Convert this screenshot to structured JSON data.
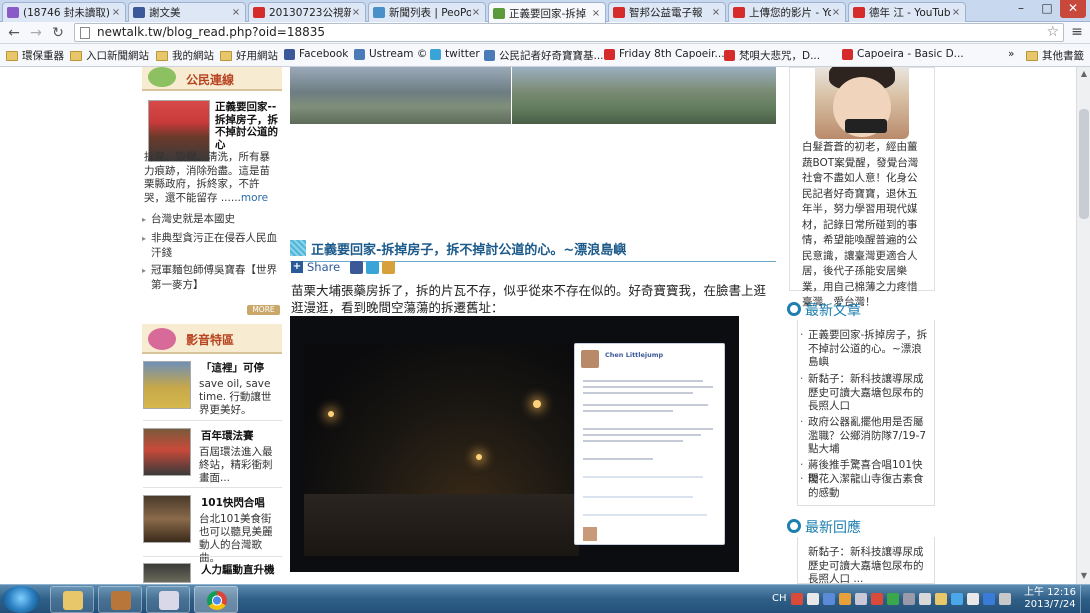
{
  "browser": {
    "tabs": [
      {
        "title": "(18746 封未讀取)",
        "icon": "mail"
      },
      {
        "title": "謝文美",
        "icon": "facebook"
      },
      {
        "title": "20130723公視新",
        "icon": "youtube"
      },
      {
        "title": "新聞列表 | PeoPo",
        "icon": "peopo"
      },
      {
        "title": "正義要回家-拆掉",
        "icon": "newtalk",
        "active": true
      },
      {
        "title": "智邦公益電子報",
        "icon": "youtube"
      },
      {
        "title": "上傳您的影片 - Yo",
        "icon": "youtube"
      },
      {
        "title": "德年 江 - YouTub",
        "icon": "youtube"
      }
    ],
    "url": "newtalk.tw/blog_read.php?oid=18835",
    "window_controls": [
      "–",
      "□",
      "✕"
    ],
    "bookmarks": [
      {
        "label": "環保重器",
        "type": "folder"
      },
      {
        "label": "入口新聞網站",
        "type": "folder"
      },
      {
        "label": "我的網站",
        "type": "folder"
      },
      {
        "label": "好用網站",
        "type": "folder"
      },
      {
        "label": "Facebook",
        "type": "facebook"
      },
      {
        "label": "Ustream ©",
        "type": "ustream"
      },
      {
        "label": "twitter",
        "type": "twitter"
      },
      {
        "label": "公民記者好奇寶寶基...",
        "type": "ustream"
      },
      {
        "label": "Friday 8th Capoeir...",
        "type": "youtube"
      },
      {
        "label": "梵唄大悲咒，D...",
        "type": "youtube"
      },
      {
        "label": "Capoeira - Basic D...",
        "type": "youtube"
      },
      {
        "label": "»",
        "type": "more"
      },
      {
        "label": "其他書籤",
        "type": "folder"
      }
    ]
  },
  "left_sidebar": {
    "citizen_links_title": "公民連線",
    "featured": {
      "title": "正義要回家--拆掉房子，拆不掉討公道的心",
      "snippet": "拆屋、毀欄、淸洗，所有暴力痕跡，消除殆盡。這是苗栗縣政府，拆終家，不許哭，還不能留存 ......",
      "more": "more"
    },
    "links": [
      "台灣史就是本國史",
      "非典型貪污正在侵吞人民血汗錢",
      "冠軍麵包師傅吳寶春【世界第一麥方】"
    ],
    "more_badge": "MORE",
    "video_title": "影音特區",
    "videos": [
      {
        "title": "「這裡」可停",
        "desc": "save oil, save time. 行動讓世界更美好。"
      },
      {
        "title": "百年環法賽",
        "desc": "百屆環法進入最終站，精彩衝刺畫面..."
      },
      {
        "title": "101快閃合唱",
        "desc": "台北101美食街也可以聽見美麗動人的台灣歌曲。"
      },
      {
        "title": "人力驅動直升機",
        "desc": ""
      }
    ]
  },
  "article": {
    "title": "正義要回家-拆掉房子，拆不掉討公道的心。~漂浪島嶼",
    "share_label": "Share",
    "body": "苗栗大埔張藥房拆了，拆的片瓦不存，似乎從來不存在似的。好奇寶寶我，在臉書上逛逛漫逛，看到晚間空蕩蕩的拆遷舊址："
  },
  "right_sidebar": {
    "bio": "白髮蒼蒼的初老，經由薑蔬BOT案覺醒，發覺台灣社會不盡如人意！化身公民記者好奇寶寶，退休五年半，努力學習用現代媒材，記錄日常所碰到的事情，希望能喚醒普遍的公民意識，讓臺灣更適合人居，後代子孫能安居樂業，用自己棉薄之力疼惜臺灣、愛台灣！",
    "latest_title": "最新文章",
    "latest": [
      "正義要回家-拆掉房子，拆不掉討公道的心。~漂浪島嶼",
      "新黏子：新科技讓導尿成歷史可讀大嘉塘包尿布的長照人口",
      "政府公器亂擺他用是否屬濫職？公鄉消防隊7/19-7點大埔",
      "蔣後推手驚喜合唱101快閃",
      "璦花入潔龍山寺復古素食的感動"
    ],
    "comments_title": "最新回應",
    "comments": [
      "新黏子：新科技讓導尿成歷史可讀大嘉塘包尿布的長照人口 ..."
    ]
  },
  "fb_post": {
    "name": "Chen Littlejump"
  },
  "taskbar": {
    "lang": "CH",
    "time": "上午 12:16",
    "date": "2013/7/24"
  }
}
